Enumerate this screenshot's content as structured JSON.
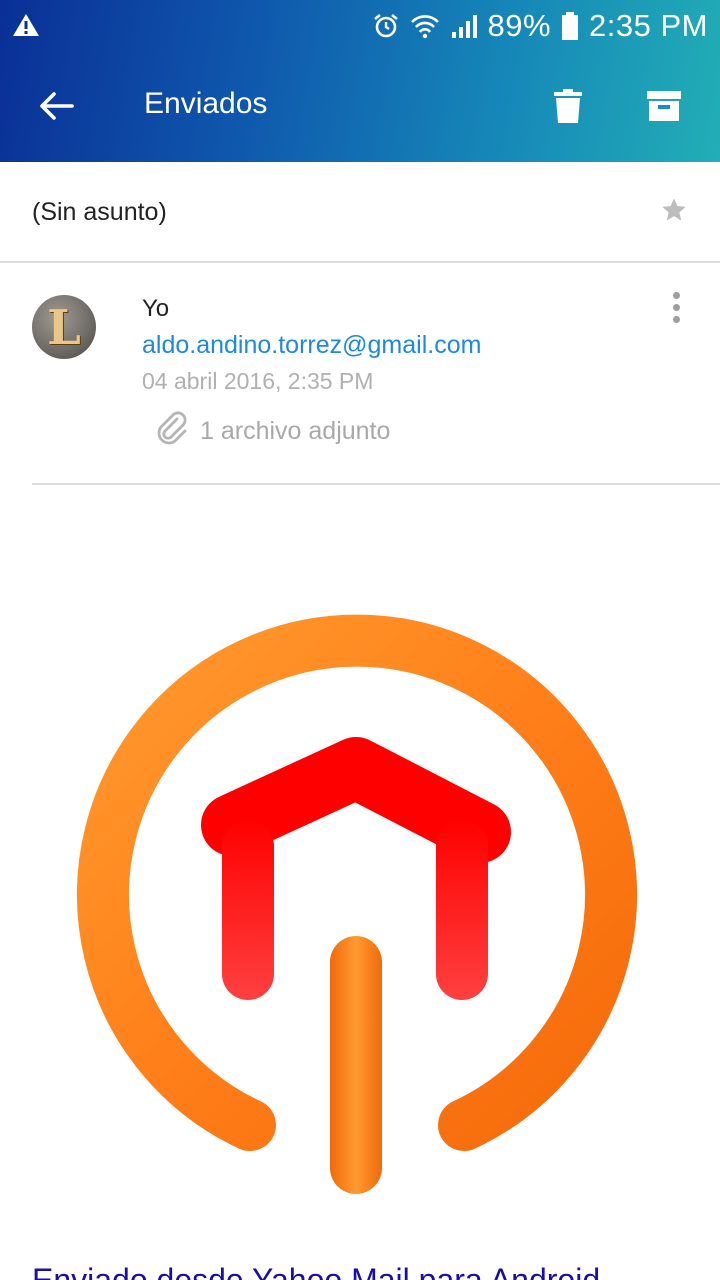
{
  "status_bar": {
    "battery": "89%",
    "time": "2:35 PM",
    "icons": [
      "warning-icon",
      "alarm-icon",
      "wifi-icon",
      "signal-icon",
      "battery-icon"
    ]
  },
  "toolbar": {
    "title": "Enviados",
    "back_icon": "back-arrow-icon",
    "delete_icon": "trash-icon",
    "archive_icon": "archive-icon"
  },
  "message": {
    "subject": "(Sin asunto)",
    "starred": false,
    "sender": {
      "avatar_letter": "L",
      "name": "Yo",
      "email": "aldo.andino.torrez@gmail.com",
      "date": "04 abril 2016, 2:35 PM"
    },
    "attachments_label": "1 archivo adjunto"
  },
  "body": {
    "footer_link": "Enviado desde Yahoo Mail para Android"
  },
  "colors": {
    "appbar_start": "#0a2f96",
    "appbar_end": "#22aeb6",
    "email_link": "#1e88e5",
    "logo_orange": "#ff7f1a",
    "logo_red": "#ff1a1a"
  }
}
